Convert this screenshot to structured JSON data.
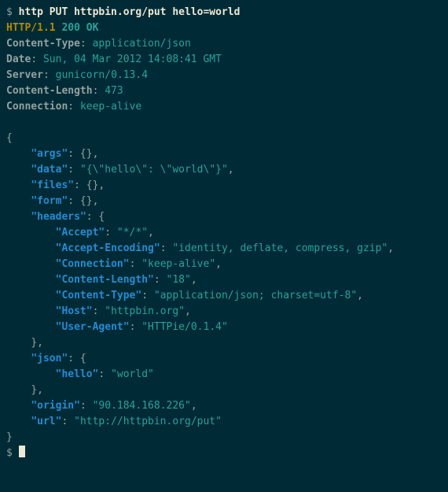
{
  "prompt_symbol": "$",
  "command": "http PUT httpbin.org/put hello=world",
  "response": {
    "http_version": "HTTP/1.1",
    "status_code": "200",
    "status_text": "OK",
    "headers": [
      {
        "key": "Content-Type",
        "value": "application/json"
      },
      {
        "key": "Date",
        "value": "Sun, 04 Mar 2012 14:08:41 GMT"
      },
      {
        "key": "Server",
        "value": "gunicorn/0.13.4"
      },
      {
        "key": "Content-Length",
        "value": "473"
      },
      {
        "key": "Connection",
        "value": "keep-alive"
      }
    ]
  },
  "body": {
    "args": {},
    "data": "{\\\"hello\\\": \\\"world\\\"}",
    "files": {},
    "form": {},
    "headers": {
      "Accept": "*/*",
      "Accept-Encoding": "identity, deflate, compress, gzip",
      "Connection": "keep-alive",
      "Content-Length": "18",
      "Content-Type": "application/json; charset=utf-8",
      "Host": "httpbin.org",
      "User-Agent": "HTTPie/0.1.4"
    },
    "json": {
      "hello": "world"
    },
    "origin": "90.184.168.226",
    "url": "http://httpbin.org/put"
  },
  "keys": {
    "args": "args",
    "data": "data",
    "files": "files",
    "form": "form",
    "headers": "headers",
    "Accept": "Accept",
    "AcceptEncoding": "Accept-Encoding",
    "Connection": "Connection",
    "ContentLength": "Content-Length",
    "ContentType": "Content-Type",
    "Host": "Host",
    "UserAgent": "User-Agent",
    "json": "json",
    "hello": "hello",
    "origin": "origin",
    "url": "url"
  }
}
